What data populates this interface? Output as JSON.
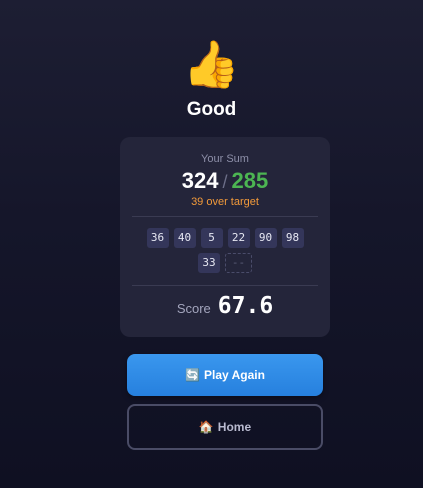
{
  "result": {
    "icon": "thumbs-up-icon",
    "emoji": "👍",
    "title": "Good"
  },
  "card": {
    "sum_label": "Your Sum",
    "sum_value": "324",
    "separator": "/",
    "target_value": "285",
    "over_text": "39 over target",
    "numbers": [
      "36",
      "40",
      "5",
      "22",
      "90",
      "98",
      "33"
    ],
    "empty_slot": "--",
    "score_label": "Score",
    "score_value": "67.6"
  },
  "buttons": {
    "play_again_icon": "🔄",
    "play_again_label": "Play Again",
    "home_icon": "🏠",
    "home_label": "Home"
  },
  "colors": {
    "background": "#15162a",
    "card": "#24253a",
    "target": "#4cb552",
    "over": "#f29a3a",
    "primary_button": "#2f8ce8"
  }
}
